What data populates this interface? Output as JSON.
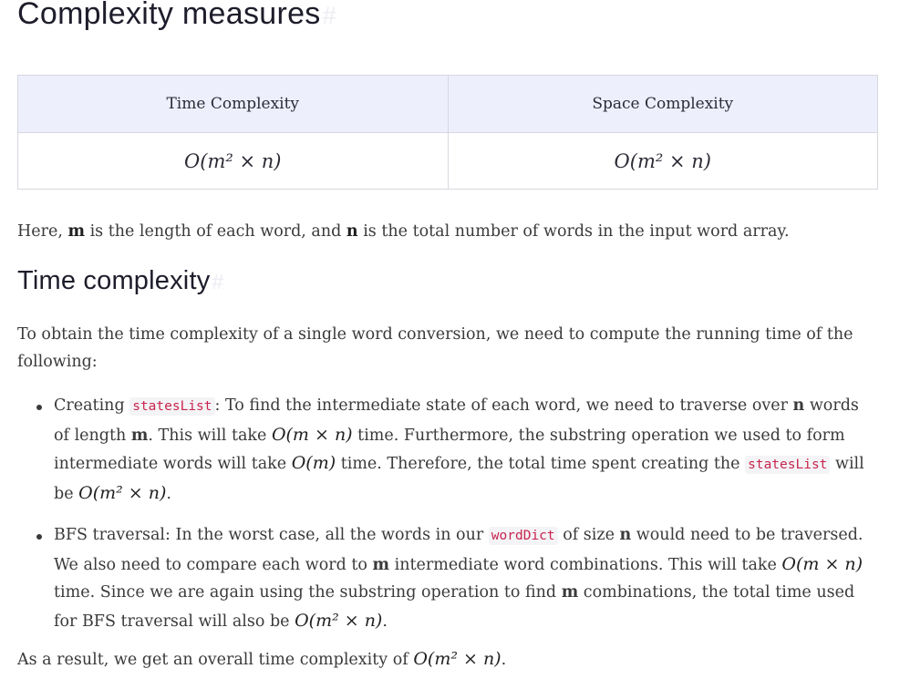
{
  "heading": "Complexity measures",
  "anchor_glyph": "#",
  "table": {
    "headers": [
      "Time Complexity",
      "Space Complexity"
    ],
    "row": [
      "O(m² × n)",
      "O(m² × n)"
    ]
  },
  "definition": {
    "pre": "Here, ",
    "m": "m",
    "mid": " is the length of each word, and ",
    "n": "n",
    "post": " is the total number of words in the input word array."
  },
  "subheading": "Time complexity",
  "intro": "To obtain the time complexity of a single word conversion, we need to compute the running time of the following:",
  "bullet1": {
    "a": "Creating ",
    "code1": "statesList",
    "b": ": To find the intermediate state of each word, we need to traverse over ",
    "n": "n",
    "c": " words of length ",
    "m": "m",
    "d": ". This will take ",
    "math1": "O(m × n)",
    "e": " time. Furthermore, the substring operation we used to form intermediate words will take ",
    "math2": "O(m)",
    "f": " time. Therefore, the total time spent creating the ",
    "code2": "statesList",
    "g": " will be ",
    "math3": "O(m² × n)",
    "h": "."
  },
  "bullet2": {
    "a": "BFS traversal: In the worst case, all the words in our ",
    "code1": "wordDict",
    "b": " of size ",
    "n": "n",
    "c": " would need to be traversed. We also need to compare each word to ",
    "m1": "m",
    "d": " intermediate word combinations. This will take ",
    "math1": "O(m × n)",
    "e": " time. Since we are again using the substring operation to find ",
    "m2": "m",
    "f": " combinations, the total time used for BFS traversal will also be ",
    "math2": "O(m² × n)",
    "g": "."
  },
  "conclusion": {
    "pre": "As a result, we get an overall time complexity of ",
    "math": "O(m² × n)",
    "post": "."
  }
}
